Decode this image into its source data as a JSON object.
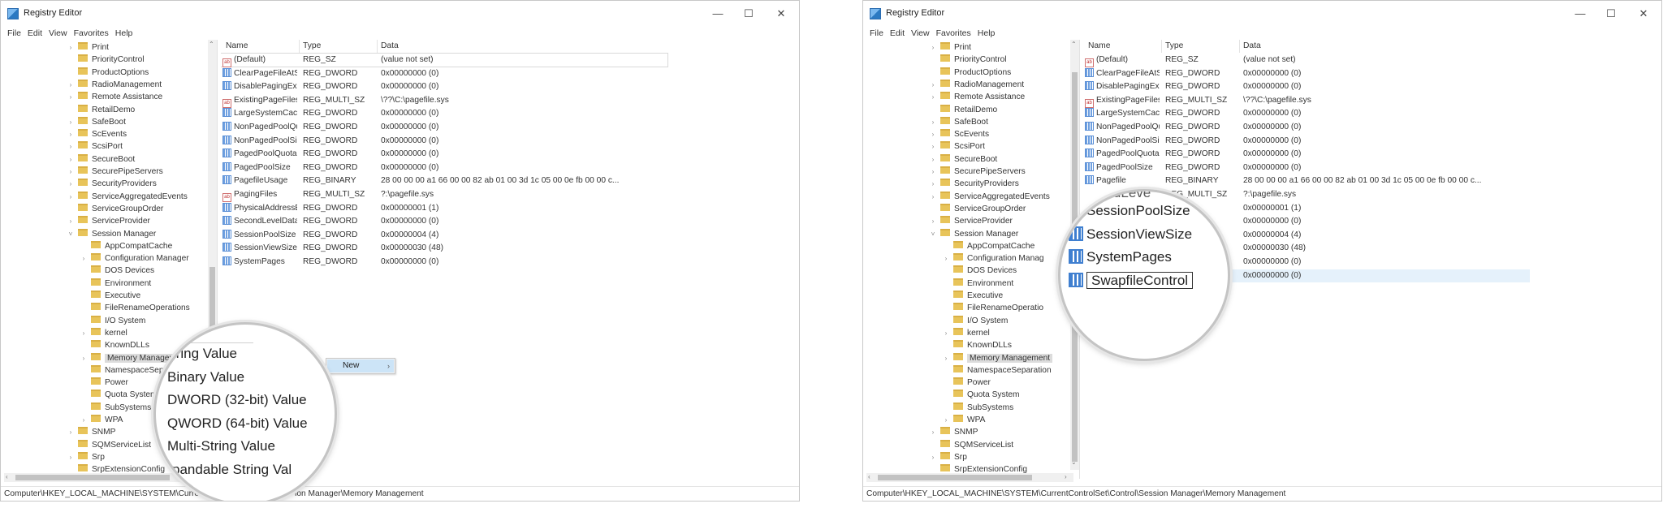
{
  "left": {
    "window_title": "Registry Editor",
    "menu": [
      "File",
      "Edit",
      "View",
      "Favorites",
      "Help"
    ],
    "tree": [
      {
        "label": "Print",
        "chev": "›"
      },
      {
        "label": "PriorityControl",
        "chev": ""
      },
      {
        "label": "ProductOptions",
        "chev": ""
      },
      {
        "label": "RadioManagement",
        "chev": "›"
      },
      {
        "label": "Remote Assistance",
        "chev": "›"
      },
      {
        "label": "RetailDemo",
        "chev": ""
      },
      {
        "label": "SafeBoot",
        "chev": "›"
      },
      {
        "label": "ScEvents",
        "chev": "›"
      },
      {
        "label": "ScsiPort",
        "chev": "›"
      },
      {
        "label": "SecureBoot",
        "chev": "›"
      },
      {
        "label": "SecurePipeServers",
        "chev": "›"
      },
      {
        "label": "SecurityProviders",
        "chev": "›"
      },
      {
        "label": "ServiceAggregatedEvents",
        "chev": "›"
      },
      {
        "label": "ServiceGroupOrder",
        "chev": ""
      },
      {
        "label": "ServiceProvider",
        "chev": "›"
      },
      {
        "label": "Session Manager",
        "chev": "˅"
      },
      {
        "label": "AppCompatCache",
        "chev": ""
      },
      {
        "label": "Configuration Manager",
        "chev": "›"
      },
      {
        "label": "DOS Devices",
        "chev": ""
      },
      {
        "label": "Environment",
        "chev": ""
      },
      {
        "label": "Executive",
        "chev": ""
      },
      {
        "label": "FileRenameOperations",
        "chev": ""
      },
      {
        "label": "I/O System",
        "chev": ""
      },
      {
        "label": "kernel",
        "chev": "›"
      },
      {
        "label": "KnownDLLs",
        "chev": ""
      },
      {
        "label": "Memory Management",
        "chev": "›"
      },
      {
        "label": "NamespaceSeparation",
        "chev": ""
      },
      {
        "label": "Power",
        "chev": ""
      },
      {
        "label": "Quota System",
        "chev": ""
      },
      {
        "label": "SubSystems",
        "chev": ""
      },
      {
        "label": "WPA",
        "chev": "›"
      },
      {
        "label": "SNMP",
        "chev": "›"
      },
      {
        "label": "SQMServiceList",
        "chev": ""
      },
      {
        "label": "Srp",
        "chev": "›"
      },
      {
        "label": "SrpExtensionConfig",
        "chev": ""
      }
    ],
    "columns": {
      "name": "Name",
      "type": "Type",
      "data": "Data"
    },
    "rows": [
      {
        "name": "(Default)",
        "type": "REG_SZ",
        "data": "(value not set)",
        "icon": "string-value-icon"
      },
      {
        "name": "ClearPageFileAtShut...",
        "type": "REG_DWORD",
        "data": "0x00000000 (0)",
        "icon": "binary-value-icon"
      },
      {
        "name": "DisablePagingExecut...",
        "type": "REG_DWORD",
        "data": "0x00000000 (0)",
        "icon": "binary-value-icon"
      },
      {
        "name": "ExistingPageFiles",
        "type": "REG_MULTI_SZ",
        "data": "\\??\\C:\\pagefile.sys",
        "icon": "string-value-icon"
      },
      {
        "name": "LargeSystemCache",
        "type": "REG_DWORD",
        "data": "0x00000000 (0)",
        "icon": "binary-value-icon"
      },
      {
        "name": "NonPagedPoolQuota",
        "type": "REG_DWORD",
        "data": "0x00000000 (0)",
        "icon": "binary-value-icon"
      },
      {
        "name": "NonPagedPoolSize",
        "type": "REG_DWORD",
        "data": "0x00000000 (0)",
        "icon": "binary-value-icon"
      },
      {
        "name": "PagedPoolQuota",
        "type": "REG_DWORD",
        "data": "0x00000000 (0)",
        "icon": "binary-value-icon"
      },
      {
        "name": "PagedPoolSize",
        "type": "REG_DWORD",
        "data": "0x00000000 (0)",
        "icon": "binary-value-icon"
      },
      {
        "name": "PagefileUsage",
        "type": "REG_BINARY",
        "data": "28 00 00 00 a1 66 00 00 82 ab 01 00 3d 1c 05 00 0e fb 00 00 c...",
        "icon": "binary-value-icon"
      },
      {
        "name": "PagingFiles",
        "type": "REG_MULTI_SZ",
        "data": "?:\\pagefile.sys",
        "icon": "string-value-icon"
      },
      {
        "name": "PhysicalAddressExten...",
        "type": "REG_DWORD",
        "data": "0x00000001 (1)",
        "icon": "binary-value-icon"
      },
      {
        "name": "SecondLevelDataCac...",
        "type": "REG_DWORD",
        "data": "0x00000000 (0)",
        "icon": "binary-value-icon"
      },
      {
        "name": "SessionPoolSize",
        "type": "REG_DWORD",
        "data": "0x00000004 (4)",
        "icon": "binary-value-icon"
      },
      {
        "name": "SessionViewSize",
        "type": "REG_DWORD",
        "data": "0x00000030 (48)",
        "icon": "binary-value-icon"
      },
      {
        "name": "SystemPages",
        "type": "REG_DWORD",
        "data": "0x00000000 (0)",
        "icon": "binary-value-icon"
      }
    ],
    "context_menu_label": "New",
    "magnifier_items": [
      "tring Value",
      "Binary Value",
      "DWORD (32-bit) Value",
      "QWORD (64-bit) Value",
      "Multi-String Value",
      "pandable String Val"
    ],
    "status_path": "Computer\\HKEY_LOCAL_MACHINE\\SYSTEM\\CurrentCont",
    "status_path_tail": "ion Manager\\Memory Management"
  },
  "right": {
    "window_title": "Registry Editor",
    "menu": [
      "File",
      "Edit",
      "View",
      "Favorites",
      "Help"
    ],
    "tree": [
      {
        "label": "Print",
        "chev": "›"
      },
      {
        "label": "PriorityControl",
        "chev": ""
      },
      {
        "label": "ProductOptions",
        "chev": ""
      },
      {
        "label": "RadioManagement",
        "chev": "›"
      },
      {
        "label": "Remote Assistance",
        "chev": "›"
      },
      {
        "label": "RetailDemo",
        "chev": ""
      },
      {
        "label": "SafeBoot",
        "chev": "›"
      },
      {
        "label": "ScEvents",
        "chev": "›"
      },
      {
        "label": "ScsiPort",
        "chev": "›"
      },
      {
        "label": "SecureBoot",
        "chev": "›"
      },
      {
        "label": "SecurePipeServers",
        "chev": "›"
      },
      {
        "label": "SecurityProviders",
        "chev": "›"
      },
      {
        "label": "ServiceAggregatedEvents",
        "chev": "›"
      },
      {
        "label": "ServiceGroupOrder",
        "chev": ""
      },
      {
        "label": "ServiceProvider",
        "chev": "›"
      },
      {
        "label": "Session Manager",
        "chev": "˅"
      },
      {
        "label": "AppCompatCache",
        "chev": ""
      },
      {
        "label": "Configuration Manag",
        "chev": "›"
      },
      {
        "label": "DOS Devices",
        "chev": ""
      },
      {
        "label": "Environment",
        "chev": ""
      },
      {
        "label": "Executive",
        "chev": ""
      },
      {
        "label": "FileRenameOperatio",
        "chev": ""
      },
      {
        "label": "I/O System",
        "chev": ""
      },
      {
        "label": "kernel",
        "chev": "›"
      },
      {
        "label": "KnownDLLs",
        "chev": ""
      },
      {
        "label": "Memory Management",
        "chev": "›"
      },
      {
        "label": "NamespaceSeparation",
        "chev": ""
      },
      {
        "label": "Power",
        "chev": ""
      },
      {
        "label": "Quota System",
        "chev": ""
      },
      {
        "label": "SubSystems",
        "chev": ""
      },
      {
        "label": "WPA",
        "chev": "›"
      },
      {
        "label": "SNMP",
        "chev": "›"
      },
      {
        "label": "SQMServiceList",
        "chev": ""
      },
      {
        "label": "Srp",
        "chev": "›"
      },
      {
        "label": "SrpExtensionConfig",
        "chev": ""
      }
    ],
    "columns": {
      "name": "Name",
      "type": "Type",
      "data": "Data"
    },
    "rows": [
      {
        "name": "(Default)",
        "type": "REG_SZ",
        "data": "(value not set)",
        "icon": "string-value-icon"
      },
      {
        "name": "ClearPageFileAtShut...",
        "type": "REG_DWORD",
        "data": "0x00000000 (0)",
        "icon": "binary-value-icon"
      },
      {
        "name": "DisablePagingExecut...",
        "type": "REG_DWORD",
        "data": "0x00000000 (0)",
        "icon": "binary-value-icon"
      },
      {
        "name": "ExistingPageFiles",
        "type": "REG_MULTI_SZ",
        "data": "\\??\\C:\\pagefile.sys",
        "icon": "string-value-icon"
      },
      {
        "name": "LargeSystemCache",
        "type": "REG_DWORD",
        "data": "0x00000000 (0)",
        "icon": "binary-value-icon"
      },
      {
        "name": "NonPagedPoolQuota",
        "type": "REG_DWORD",
        "data": "0x00000000 (0)",
        "icon": "binary-value-icon"
      },
      {
        "name": "NonPagedPoolSize",
        "type": "REG_DWORD",
        "data": "0x00000000 (0)",
        "icon": "binary-value-icon"
      },
      {
        "name": "PagedPoolQuota",
        "type": "REG_DWORD",
        "data": "0x00000000 (0)",
        "icon": "binary-value-icon"
      },
      {
        "name": "PagedPoolSize",
        "type": "REG_DWORD",
        "data": "0x00000000 (0)",
        "icon": "binary-value-icon"
      },
      {
        "name": "Pagefile",
        "type": "REG_BINARY",
        "data": "28 00 00 00 a1 66 00 00 82 ab 01 00 3d 1c 05 00 0e fb 00 00 c...",
        "icon": "binary-value-icon"
      },
      {
        "name": "",
        "type": "REG_MULTI_SZ",
        "data": "?:\\pagefile.sys",
        "icon": ""
      },
      {
        "name": "",
        "type": "ORD",
        "data": "0x00000001 (1)",
        "icon": ""
      },
      {
        "name": "",
        "type": "ORD",
        "data": "0x00000000 (0)",
        "icon": ""
      },
      {
        "name": "",
        "type": "ORD",
        "data": "0x00000004 (4)",
        "icon": ""
      },
      {
        "name": "",
        "type": "ORD",
        "data": "0x00000030 (48)",
        "icon": ""
      },
      {
        "name": "",
        "type": "ORD",
        "data": "0x00000000 (0)",
        "icon": ""
      },
      {
        "name": "",
        "type": "ORD",
        "data": "0x00000000 (0)",
        "icon": ""
      }
    ],
    "magnifier_items": [
      "SessionPoolSize",
      "SessionViewSize",
      "SystemPages",
      "SwapfileControl"
    ],
    "magnifier_partial": "ondLeve",
    "status_path": "Computer\\HKEY_LOCAL_MACHINE\\SYSTEM\\CurrentControlSet\\Control\\Session Manager\\Memory Management"
  },
  "window_controls": {
    "minimize": "—",
    "maximize": "☐",
    "close": "✕"
  },
  "colors": {
    "selection": "#cce4f7",
    "row_highlight": "#e5f1fb",
    "folder": "#e8c45a"
  }
}
